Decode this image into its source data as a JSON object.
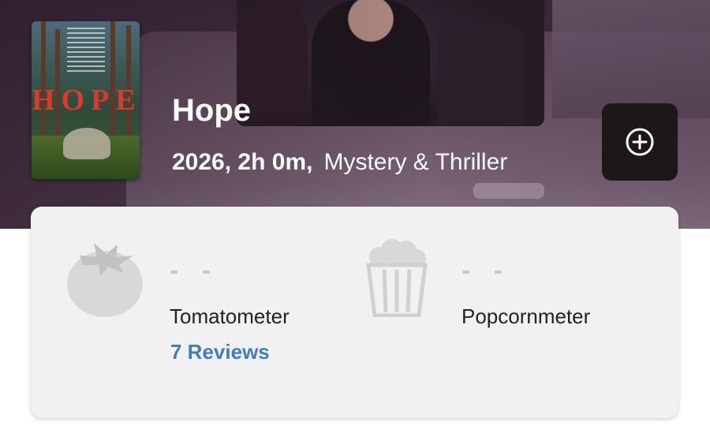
{
  "movie": {
    "title": "Hope",
    "year_runtime": "2026, 2h 0m,",
    "genre": "Mystery & Thriller",
    "poster_text": "HOPE"
  },
  "actions": {
    "add_icon": "plus-circle-icon"
  },
  "scores": {
    "tomatometer": {
      "value": "- -",
      "label": "Tomatometer",
      "reviews_link": "7 Reviews",
      "icon": "tomato-icon"
    },
    "popcornmeter": {
      "value": "- -",
      "label": "Popcornmeter",
      "icon": "popcorn-icon"
    }
  },
  "colors": {
    "link": "#3f7fc0",
    "placeholder_gray": "#c9c9c9",
    "card_bg": "#f1f1f1"
  }
}
